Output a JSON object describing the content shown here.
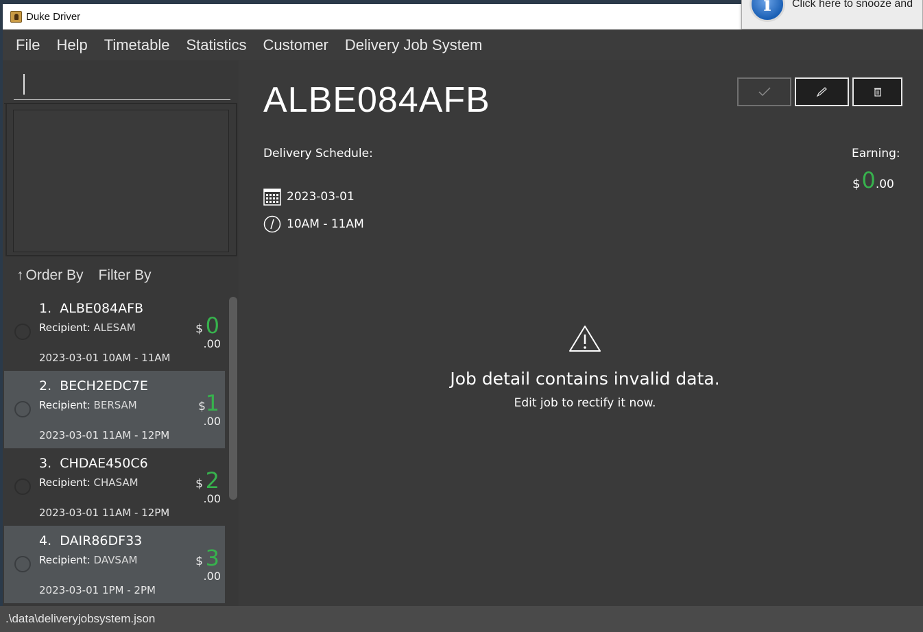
{
  "window": {
    "title": "Duke Driver"
  },
  "notification": {
    "text": "Click here to snooze and",
    "icon": "info-icon"
  },
  "menu": [
    "File",
    "Help",
    "Timetable",
    "Statistics",
    "Customer",
    "Delivery Job System"
  ],
  "command": {
    "value": "",
    "placeholder": ""
  },
  "list_controls": {
    "order_arrow": "↑",
    "order_label": "Order By",
    "filter_label": "Filter By"
  },
  "jobs": [
    {
      "index": "1.",
      "id": "ALBE084AFB",
      "recipient_label": "Recipient:",
      "recipient": "ALESAM",
      "datetime": "2023-03-01 10AM - 11AM",
      "dollar": "$",
      "amount": "0",
      "cents": ".00"
    },
    {
      "index": "2.",
      "id": "BECH2EDC7E",
      "recipient_label": "Recipient:",
      "recipient": "BERSAM",
      "datetime": "2023-03-01 11AM - 12PM",
      "dollar": "$",
      "amount": "1",
      "cents": ".00"
    },
    {
      "index": "3.",
      "id": "CHDAE450C6",
      "recipient_label": "Recipient:",
      "recipient": "CHASAM",
      "datetime": "2023-03-01 11AM - 12PM",
      "dollar": "$",
      "amount": "2",
      "cents": ".00"
    },
    {
      "index": "4.",
      "id": "DAIR86DF33",
      "recipient_label": "Recipient:",
      "recipient": "DAVSAM",
      "datetime": "2023-03-01 1PM  - 2PM",
      "dollar": "$",
      "amount": "3",
      "cents": ".00"
    }
  ],
  "detail": {
    "job_id": "ALBE084AFB",
    "schedule_label": "Delivery Schedule:",
    "date": "2023-03-01",
    "time": "10AM - 11AM",
    "earning_label": "Earning:",
    "earning_dollar": "$",
    "earning_amount": "0",
    "earning_cents": ".00",
    "warning_title": "Job detail contains invalid data.",
    "warning_sub": "Edit job to rectify it now.",
    "buttons": {
      "done": "check-icon",
      "edit": "pencil-icon",
      "delete": "trash-icon"
    }
  },
  "status": {
    "path": ".\\data\\deliveryjobsystem.json"
  },
  "colors": {
    "accent_green": "#37b24d",
    "panel_dark": "#383838",
    "panel_highlight": "#515558"
  }
}
